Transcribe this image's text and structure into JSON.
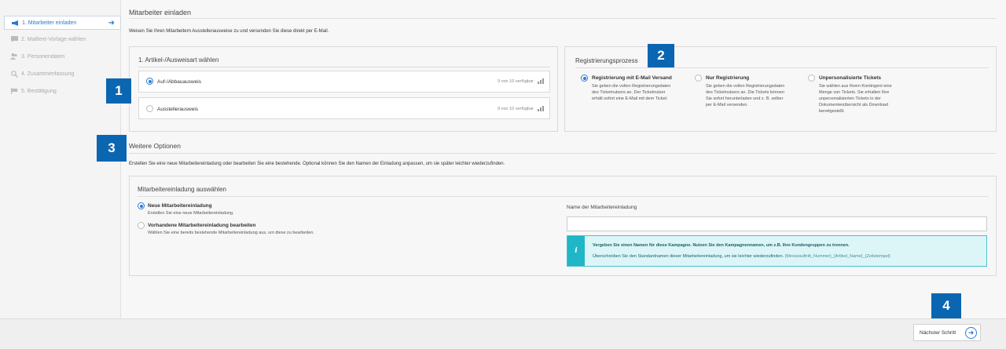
{
  "sidebar": {
    "items": [
      {
        "label": "1. Mitarbeiter einladen",
        "icon": "megaphone-icon",
        "active": true
      },
      {
        "label": "2. Mailtext-Vorlage wählen",
        "icon": "chat-icon",
        "active": false
      },
      {
        "label": "3. Personendaten",
        "icon": "people-icon",
        "active": false
      },
      {
        "label": "4. Zusammenfassung",
        "icon": "search-icon",
        "active": false
      },
      {
        "label": "5. Bestätigung",
        "icon": "flag-icon",
        "active": false
      }
    ]
  },
  "page": {
    "title": "Mitarbeiter einladen",
    "intro": "Weisen Sie Ihren Mitarbeitern Ausstellerausweise zu und versenden Sie diese direkt per E-Mail."
  },
  "article": {
    "title": "1. Artikel-/Ausweisart wählen",
    "options": [
      {
        "label": "Auf-/Abbauausweis",
        "count": "9 von 10 verfügbar",
        "checked": true
      },
      {
        "label": "Ausstellerausweis",
        "count": "9 von 10 verfügbar",
        "checked": false
      }
    ]
  },
  "registration": {
    "title": "Registrierungsprozess",
    "options": [
      {
        "title": "Registrierung mit E-Mail Versand",
        "desc": [
          "Sie geben die vollen Registrierungsdaten",
          "des Ticketnutzers an. Der Ticketnutzer",
          "erhält sofort eine E-Mail mit dem Ticket."
        ],
        "checked": true
      },
      {
        "title": "Nur Registrierung",
        "desc": [
          "Sie geben die vollen Registrierungsdaten",
          "des Ticketnutzers an. Die Tickets können",
          "Sie sofort herunterladen und z. B. selber",
          "per E-Mail versenden."
        ],
        "checked": false
      },
      {
        "title": "Unpersonalisierte Tickets",
        "desc": [
          "Sie wählen aus Ihrem Kontingent eine",
          "Menge von Tickets. Sie erhalten Ihre",
          "unpersonalisierten Tickets in der",
          "Dokumentenübersicht als Download",
          "bereitgestellt."
        ],
        "checked": false
      }
    ]
  },
  "further": {
    "title": "Weitere Optionen",
    "desc": "Erstellen Sie eine neue Mitarbeitereinladung oder bearbeiten Sie eine bestehende. Optional können Sie den Namen der Einladung anpassen, um sie später leichter wiederzufinden."
  },
  "invitation": {
    "title": "Mitarbeitereinladung auswählen",
    "options": [
      {
        "label": "Neue Mitarbeitereinladung",
        "sub": "Erstellen Sie eine neue Mitarbeitereinladung.",
        "checked": true
      },
      {
        "label": "Vorhandene Mitarbeitereinladung bearbeiten",
        "sub": "Wählen Sie eine bereits bestehende Mitarbeitereinladung aus, um diese zu bearbeiten.",
        "checked": false
      }
    ],
    "name_label": "Name der Mitarbeitereinladung",
    "name_value": "",
    "info_bold": "Vergeben Sie einen Namen für diese Kampagne. Nutzen Sie den Kampagnennamen, um z.B. Ihre Kundengruppen zu trennen.",
    "info_text": "Überschreiben Sie den Standardnamen dieser Mitarbeitereinladung, um sie leichter wiederzufinden.",
    "info_pattern": "{Messeauftritt_Nummer}_{Artikel_Name}_{Zeitstempel}"
  },
  "badges": [
    "1",
    "2",
    "3",
    "4"
  ],
  "footer": {
    "next_label": "Nächster Schritt"
  },
  "colors": {
    "accent": "#2a7ad5",
    "badge": "#0b66b2",
    "info": "#1fb6c8"
  }
}
